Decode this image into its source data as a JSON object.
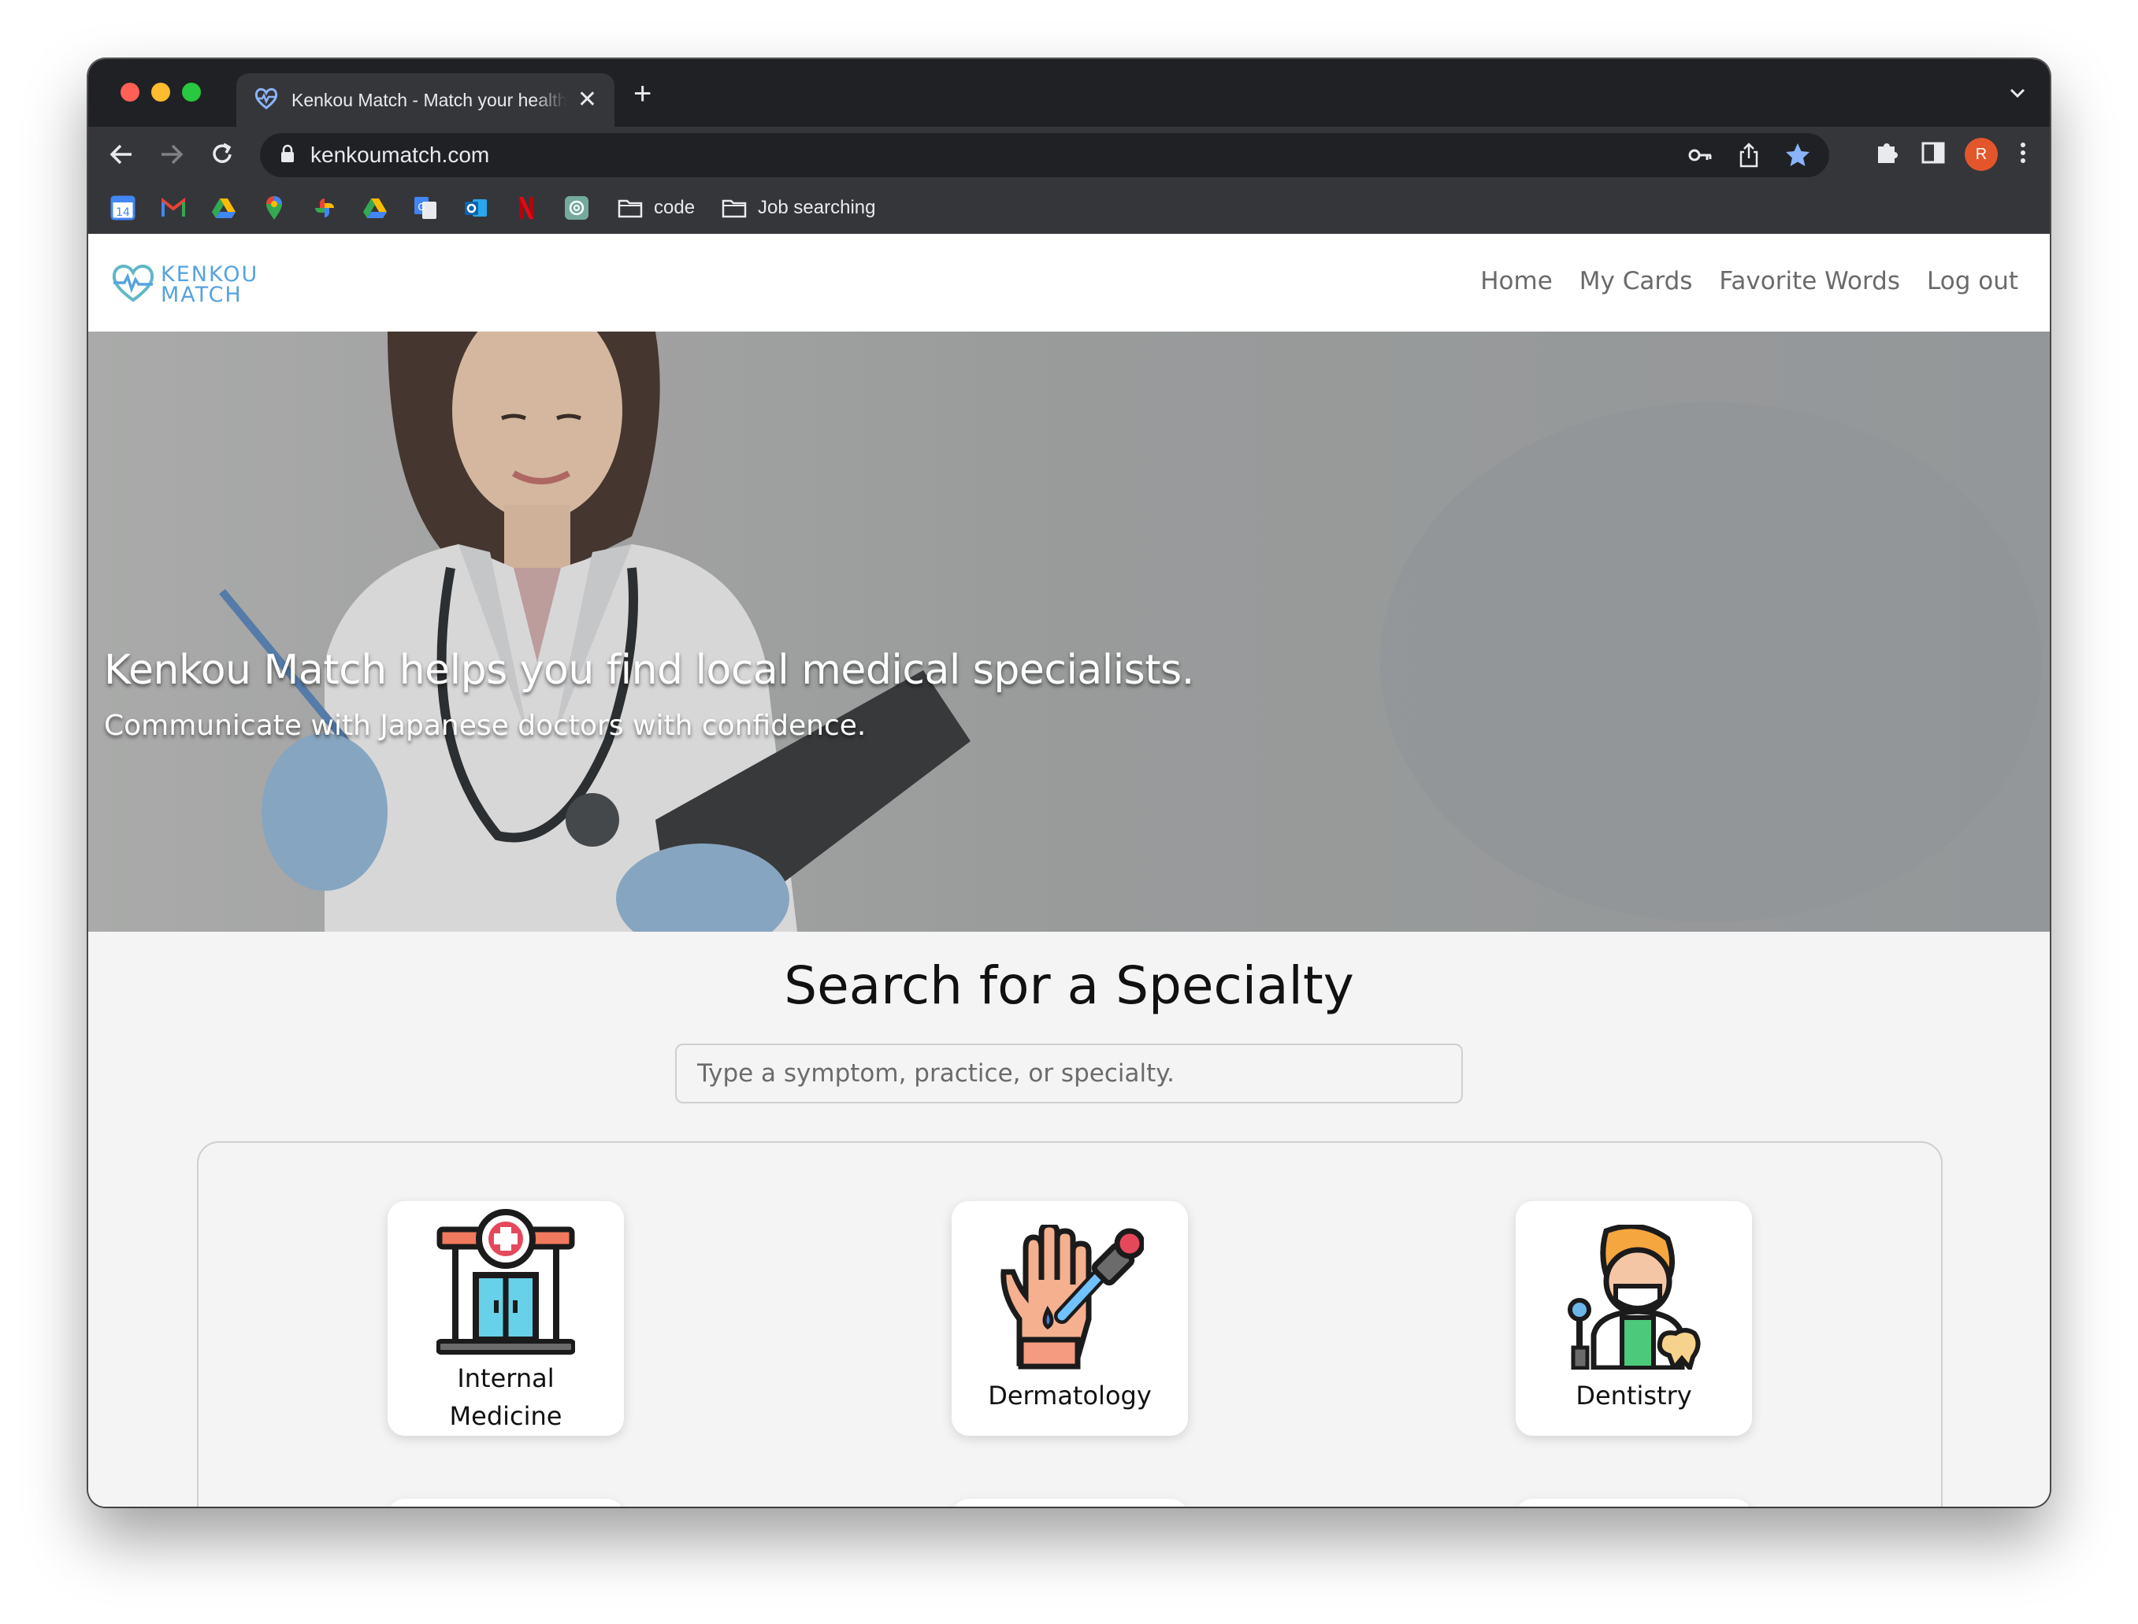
{
  "browser": {
    "tab_title": "Kenkou Match - Match your health",
    "tab_close": "✕",
    "new_tab": "+",
    "url": "kenkoumatch.com",
    "avatar_initial": "R",
    "bookmarks": [
      {
        "icon": "google-calendar-icon",
        "label": "14"
      },
      {
        "icon": "gmail-icon"
      },
      {
        "icon": "google-drive-icon"
      },
      {
        "icon": "google-maps-icon"
      },
      {
        "icon": "google-photos-icon"
      },
      {
        "icon": "google-drive-icon"
      },
      {
        "icon": "google-translate-icon"
      },
      {
        "icon": "outlook-icon"
      },
      {
        "icon": "netflix-icon"
      },
      {
        "icon": "chatgpt-icon"
      }
    ],
    "folders": [
      "code",
      "Job searching"
    ]
  },
  "site": {
    "logo_line1": "KENKOU",
    "logo_line2": "MATCH",
    "nav": [
      "Home",
      "My Cards",
      "Favorite Words",
      "Log out"
    ],
    "hero_title": "Kenkou Match helps you find local medical specialists.",
    "hero_subtitle": "Communicate with Japanese doctors with confidence.",
    "search_title": "Search for a Specialty",
    "search_placeholder": "Type a symptom, practice, or specialty.",
    "specialties": [
      {
        "line1": "Internal",
        "line2": "Medicine",
        "icon": "hospital-icon"
      },
      {
        "line1": "Dermatology",
        "icon": "hand-dropper-icon"
      },
      {
        "line1": "Dentistry",
        "icon": "dentist-icon"
      }
    ]
  },
  "colors": {
    "brand": "#56a3df",
    "chrome_dark": "#202124",
    "chrome_toolbar": "#35363a",
    "avatar": "#e3562c",
    "hero_bg": "#a4a6a6"
  }
}
